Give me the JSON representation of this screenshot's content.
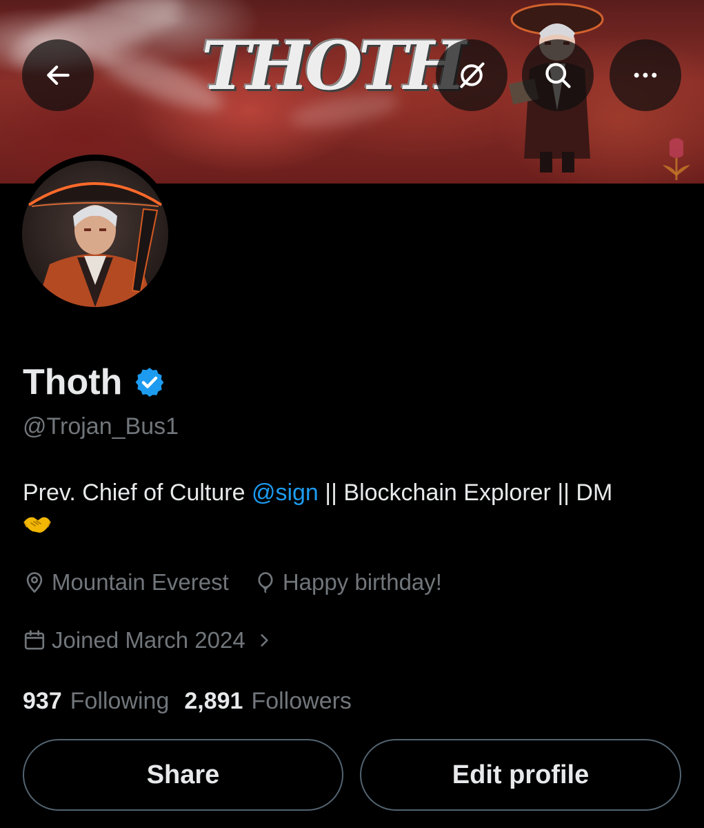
{
  "banner": {
    "title_text": "THOTH"
  },
  "nav": {
    "back_icon": "arrow-left-icon",
    "grok_icon": "grok-icon",
    "search_icon": "search-icon",
    "more_icon": "more-horizontal-icon"
  },
  "profile": {
    "name": "Thoth",
    "handle": "@Trojan_Bus1",
    "verified": true,
    "bio_prefix": "Prev. Chief of Culture ",
    "bio_mention": "@sign",
    "bio_suffix": " || Blockchain Explorer  || DM",
    "bio_emoji": "handshake-emoji",
    "location": "Mountain Everest",
    "birthday": "Happy birthday!",
    "joined": "Joined March 2024"
  },
  "stats": {
    "following_count": "937",
    "following_label": "Following",
    "followers_count": "2,891",
    "followers_label": "Followers"
  },
  "actions": {
    "share_label": "Share",
    "edit_label": "Edit profile"
  },
  "colors": {
    "background": "#000000",
    "text_primary": "#e7e9ea",
    "text_secondary": "#71767b",
    "accent": "#1d9bf0",
    "button_border": "#536471"
  }
}
